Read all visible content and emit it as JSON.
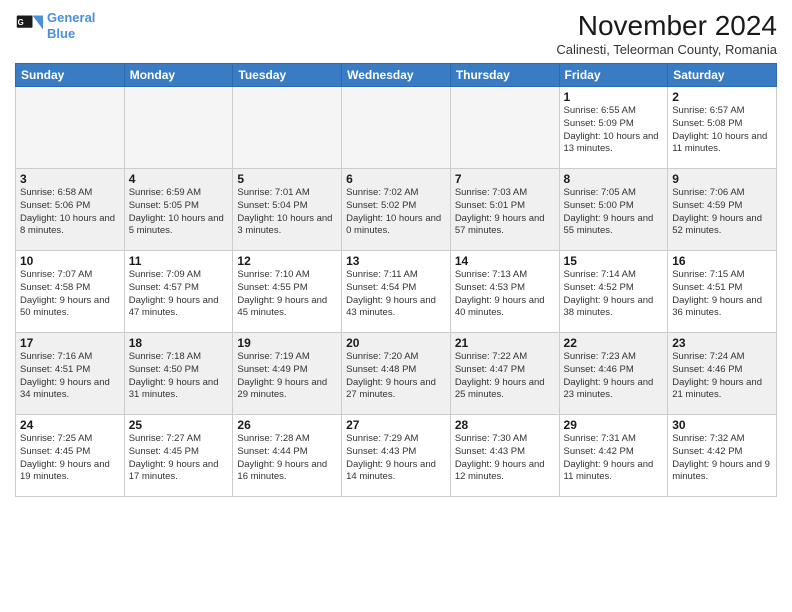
{
  "logo": {
    "line1": "General",
    "line2": "Blue"
  },
  "title": "November 2024",
  "location": "Calinesti, Teleorman County, Romania",
  "days": [
    "Sunday",
    "Monday",
    "Tuesday",
    "Wednesday",
    "Thursday",
    "Friday",
    "Saturday"
  ],
  "weeks": [
    [
      {
        "day": "",
        "info": ""
      },
      {
        "day": "",
        "info": ""
      },
      {
        "day": "",
        "info": ""
      },
      {
        "day": "",
        "info": ""
      },
      {
        "day": "",
        "info": ""
      },
      {
        "day": "1",
        "info": "Sunrise: 6:55 AM\nSunset: 5:09 PM\nDaylight: 10 hours and 13 minutes."
      },
      {
        "day": "2",
        "info": "Sunrise: 6:57 AM\nSunset: 5:08 PM\nDaylight: 10 hours and 11 minutes."
      }
    ],
    [
      {
        "day": "3",
        "info": "Sunrise: 6:58 AM\nSunset: 5:06 PM\nDaylight: 10 hours and 8 minutes."
      },
      {
        "day": "4",
        "info": "Sunrise: 6:59 AM\nSunset: 5:05 PM\nDaylight: 10 hours and 5 minutes."
      },
      {
        "day": "5",
        "info": "Sunrise: 7:01 AM\nSunset: 5:04 PM\nDaylight: 10 hours and 3 minutes."
      },
      {
        "day": "6",
        "info": "Sunrise: 7:02 AM\nSunset: 5:02 PM\nDaylight: 10 hours and 0 minutes."
      },
      {
        "day": "7",
        "info": "Sunrise: 7:03 AM\nSunset: 5:01 PM\nDaylight: 9 hours and 57 minutes."
      },
      {
        "day": "8",
        "info": "Sunrise: 7:05 AM\nSunset: 5:00 PM\nDaylight: 9 hours and 55 minutes."
      },
      {
        "day": "9",
        "info": "Sunrise: 7:06 AM\nSunset: 4:59 PM\nDaylight: 9 hours and 52 minutes."
      }
    ],
    [
      {
        "day": "10",
        "info": "Sunrise: 7:07 AM\nSunset: 4:58 PM\nDaylight: 9 hours and 50 minutes."
      },
      {
        "day": "11",
        "info": "Sunrise: 7:09 AM\nSunset: 4:57 PM\nDaylight: 9 hours and 47 minutes."
      },
      {
        "day": "12",
        "info": "Sunrise: 7:10 AM\nSunset: 4:55 PM\nDaylight: 9 hours and 45 minutes."
      },
      {
        "day": "13",
        "info": "Sunrise: 7:11 AM\nSunset: 4:54 PM\nDaylight: 9 hours and 43 minutes."
      },
      {
        "day": "14",
        "info": "Sunrise: 7:13 AM\nSunset: 4:53 PM\nDaylight: 9 hours and 40 minutes."
      },
      {
        "day": "15",
        "info": "Sunrise: 7:14 AM\nSunset: 4:52 PM\nDaylight: 9 hours and 38 minutes."
      },
      {
        "day": "16",
        "info": "Sunrise: 7:15 AM\nSunset: 4:51 PM\nDaylight: 9 hours and 36 minutes."
      }
    ],
    [
      {
        "day": "17",
        "info": "Sunrise: 7:16 AM\nSunset: 4:51 PM\nDaylight: 9 hours and 34 minutes."
      },
      {
        "day": "18",
        "info": "Sunrise: 7:18 AM\nSunset: 4:50 PM\nDaylight: 9 hours and 31 minutes."
      },
      {
        "day": "19",
        "info": "Sunrise: 7:19 AM\nSunset: 4:49 PM\nDaylight: 9 hours and 29 minutes."
      },
      {
        "day": "20",
        "info": "Sunrise: 7:20 AM\nSunset: 4:48 PM\nDaylight: 9 hours and 27 minutes."
      },
      {
        "day": "21",
        "info": "Sunrise: 7:22 AM\nSunset: 4:47 PM\nDaylight: 9 hours and 25 minutes."
      },
      {
        "day": "22",
        "info": "Sunrise: 7:23 AM\nSunset: 4:46 PM\nDaylight: 9 hours and 23 minutes."
      },
      {
        "day": "23",
        "info": "Sunrise: 7:24 AM\nSunset: 4:46 PM\nDaylight: 9 hours and 21 minutes."
      }
    ],
    [
      {
        "day": "24",
        "info": "Sunrise: 7:25 AM\nSunset: 4:45 PM\nDaylight: 9 hours and 19 minutes."
      },
      {
        "day": "25",
        "info": "Sunrise: 7:27 AM\nSunset: 4:45 PM\nDaylight: 9 hours and 17 minutes."
      },
      {
        "day": "26",
        "info": "Sunrise: 7:28 AM\nSunset: 4:44 PM\nDaylight: 9 hours and 16 minutes."
      },
      {
        "day": "27",
        "info": "Sunrise: 7:29 AM\nSunset: 4:43 PM\nDaylight: 9 hours and 14 minutes."
      },
      {
        "day": "28",
        "info": "Sunrise: 7:30 AM\nSunset: 4:43 PM\nDaylight: 9 hours and 12 minutes."
      },
      {
        "day": "29",
        "info": "Sunrise: 7:31 AM\nSunset: 4:42 PM\nDaylight: 9 hours and 11 minutes."
      },
      {
        "day": "30",
        "info": "Sunrise: 7:32 AM\nSunset: 4:42 PM\nDaylight: 9 hours and 9 minutes."
      }
    ]
  ]
}
